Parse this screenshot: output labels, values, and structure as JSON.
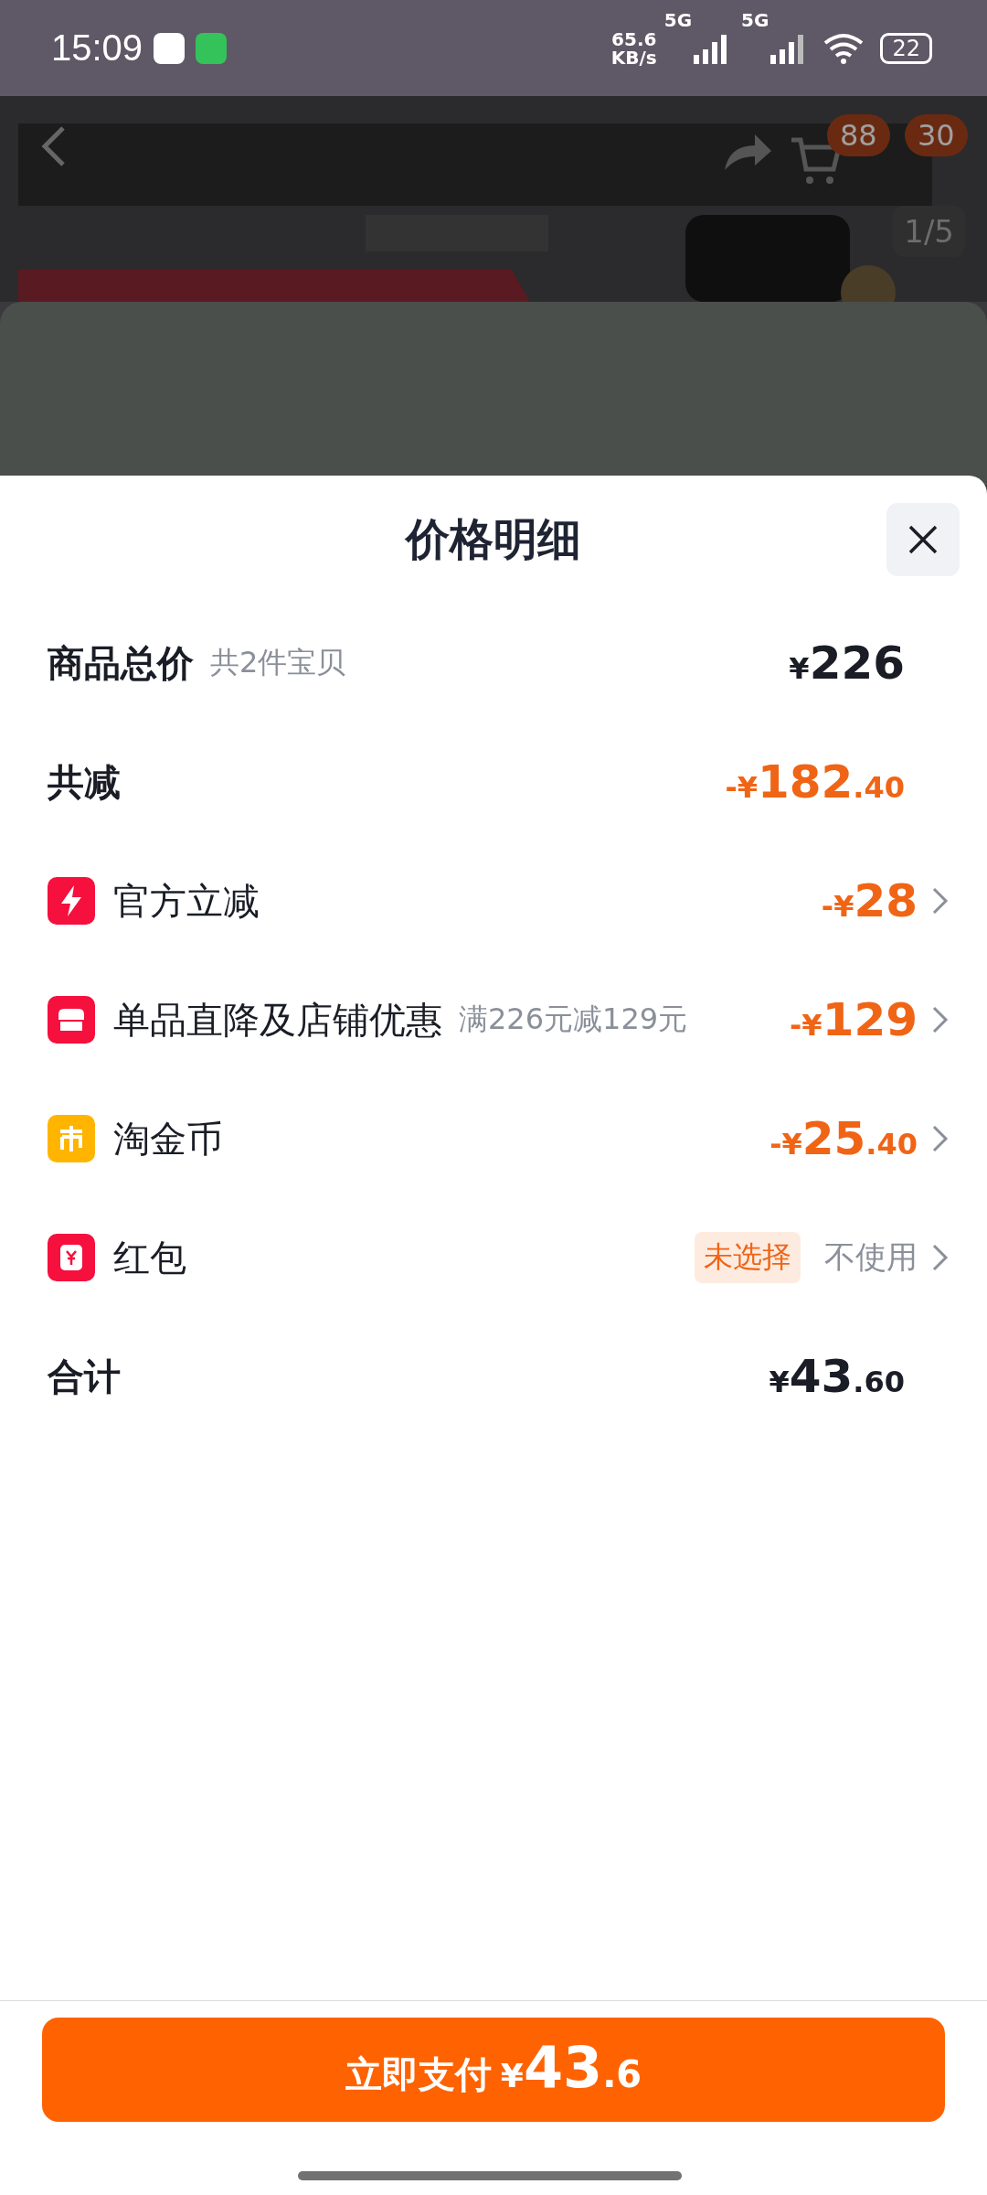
{
  "status_bar": {
    "time": "15:09",
    "speed_value": "65.6",
    "speed_unit": "KB/s",
    "network_1": "5G",
    "network_2": "5G",
    "battery": "22"
  },
  "background_page": {
    "cart_badge": "88",
    "menu_badge": "30",
    "image_counter": "1/5"
  },
  "sheet": {
    "title": "价格明细",
    "rows": [
      {
        "kind": "total",
        "label": "商品总价",
        "note": "共2件宝贝",
        "amount": {
          "currency": "¥",
          "integer": "226"
        }
      },
      {
        "kind": "discount_total",
        "label": "共减",
        "amount": {
          "sign": "-",
          "currency": "¥",
          "integer": "182",
          "decimal": ".40"
        }
      },
      {
        "kind": "official",
        "label": "官方立减",
        "amount": {
          "sign": "-",
          "currency": "¥",
          "integer": "28"
        }
      },
      {
        "kind": "store",
        "label": "单品直降及店铺优惠",
        "note": "满226元减129元",
        "amount": {
          "sign": "-",
          "currency": "¥",
          "integer": "129"
        }
      },
      {
        "kind": "coins",
        "label": "淘金币",
        "amount": {
          "sign": "-",
          "currency": "¥",
          "integer": "25",
          "decimal": ".40"
        }
      },
      {
        "kind": "red_packet",
        "label": "红包",
        "tag": "未选择",
        "value": "不使用"
      },
      {
        "kind": "total",
        "label": "合计",
        "amount": {
          "currency": "¥",
          "integer": "43",
          "decimal": ".60"
        }
      }
    ],
    "pay_button": {
      "label": "立即支付",
      "currency": "¥",
      "integer": "43",
      "decimal": ".6"
    }
  }
}
